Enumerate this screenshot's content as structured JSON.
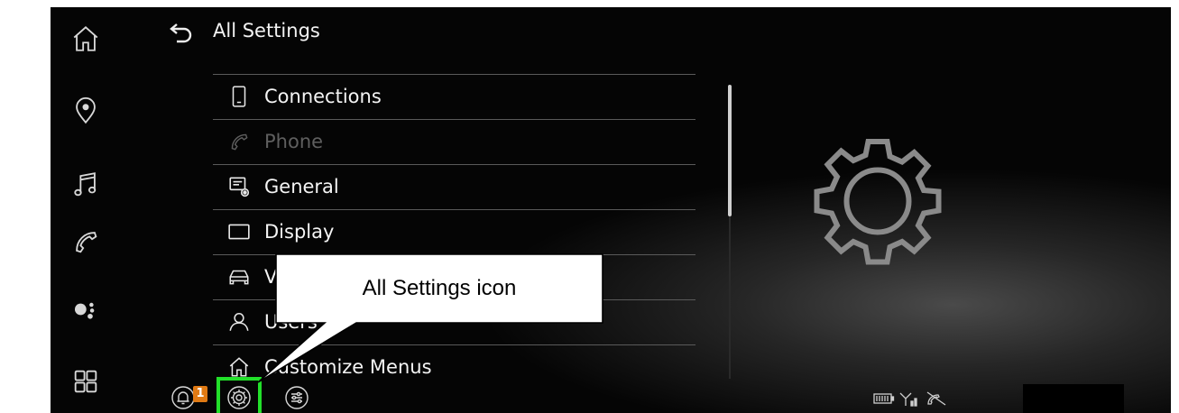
{
  "header": {
    "title": "All Settings"
  },
  "sidebar": {
    "items": [
      {
        "icon": "home-icon"
      },
      {
        "icon": "location-pin-icon"
      },
      {
        "icon": "music-note-icon"
      },
      {
        "icon": "phone-icon"
      },
      {
        "icon": "assistant-icon"
      },
      {
        "icon": "apps-grid-icon"
      }
    ]
  },
  "menu": {
    "items": [
      {
        "label": "Connections",
        "icon": "smartphone-icon",
        "enabled": true
      },
      {
        "label": "Phone",
        "icon": "phone-icon",
        "enabled": false
      },
      {
        "label": "General",
        "icon": "general-settings-icon",
        "enabled": true
      },
      {
        "label": "Display",
        "icon": "display-icon",
        "enabled": true
      },
      {
        "label": "V",
        "icon": "vehicle-icon",
        "enabled": true
      },
      {
        "label": "Users",
        "icon": "user-icon",
        "enabled": true
      },
      {
        "label": "Customize Menus",
        "icon": "home-icon",
        "enabled": true
      }
    ]
  },
  "bottom_bar": {
    "notification_count": "1",
    "buttons": [
      "notification-bell-icon",
      "settings-gear-icon",
      "quick-controls-icon"
    ],
    "status_icons": [
      "battery-icon",
      "signal-icon",
      "connection-off-icon"
    ]
  },
  "callout": {
    "text": "All Settings icon"
  },
  "colors": {
    "highlight": "#22e02a",
    "badge": "#e07a14",
    "background": "#050505"
  }
}
